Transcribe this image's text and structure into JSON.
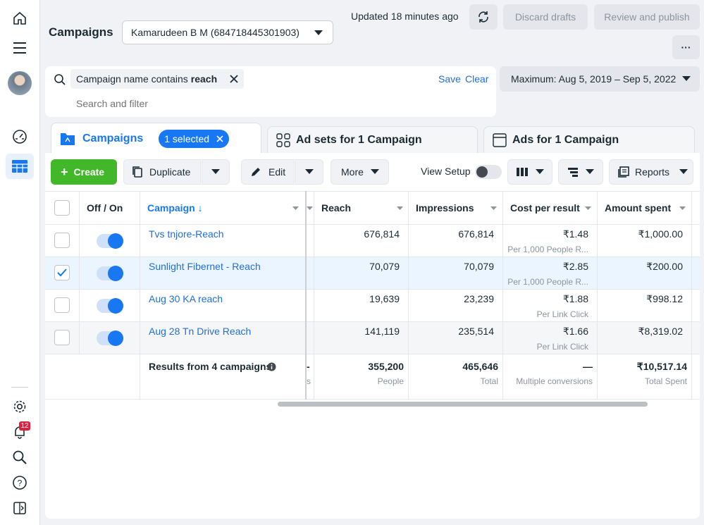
{
  "sidebar": {
    "icons": [
      "home-icon",
      "menu-icon",
      "avatar",
      "gauge-icon",
      "table-icon",
      "settings-icon",
      "bell-icon",
      "search-icon",
      "help-icon",
      "panel-icon"
    ],
    "notification_count": "12"
  },
  "header": {
    "title": "Campaigns",
    "account": "Kamarudeen B M (684718445301903)",
    "updated": "Updated 18 minutes ago",
    "discard_label": "Discard drafts",
    "review_label": "Review and publish",
    "more_label": "···"
  },
  "filter": {
    "chip_prefix": "Campaign name contains ",
    "chip_value": "reach",
    "save_label": "Save",
    "clear_label": "Clear",
    "placeholder": "Search and filter"
  },
  "date_range": "Maximum: Aug 5, 2019 – Sep 5, 2022",
  "tabs": {
    "campaigns": "Campaigns",
    "selected": "1 selected",
    "adsets": "Ad sets for 1 Campaign",
    "ads": "Ads for 1 Campaign"
  },
  "toolbar": {
    "create": "Create",
    "duplicate": "Duplicate",
    "edit": "Edit",
    "more": "More",
    "view_setup": "View Setup",
    "reports": "Reports"
  },
  "columns": {
    "offon": "Off / On",
    "campaign": "Campaign ↓",
    "reach": "Reach",
    "impressions": "Impressions",
    "cpr": "Cost per result",
    "spent": "Amount spent"
  },
  "rows": [
    {
      "name": "Tvs tnjore-Reach",
      "reach": "676,814",
      "impressions": "676,814",
      "cpr": "₹1.48",
      "cpr_sub": "Per 1,000 People R...",
      "spent": "₹1,000.00",
      "selected": false
    },
    {
      "name": "Sunlight Fibernet - Reach",
      "reach": "70,079",
      "impressions": "70,079",
      "cpr": "₹2.85",
      "cpr_sub": "Per 1,000 People R...",
      "spent": "₹200.00",
      "selected": true
    },
    {
      "name": "Aug 30 KA reach",
      "reach": "19,639",
      "impressions": "23,239",
      "cpr": "₹1.88",
      "cpr_sub": "Per Link Click",
      "spent": "₹998.12",
      "selected": false
    },
    {
      "name": "Aug 28 Tn Drive Reach",
      "reach": "141,119",
      "impressions": "235,514",
      "cpr": "₹1.66",
      "cpr_sub": "Per Link Click",
      "spent": "₹8,319.02",
      "selected": false
    }
  ],
  "totals": {
    "label": "Results from 4 campaigns",
    "partial_dash": "-",
    "partial_sub": "s",
    "reach": "355,200",
    "reach_sub": "People",
    "impressions": "465,646",
    "impressions_sub": "Total",
    "cpr": "—",
    "cpr_sub": "Multiple conversions",
    "spent": "₹10,517.14",
    "spent_sub": "Total Spent"
  },
  "colors": {
    "accent": "#1877f2",
    "create": "#42b72a",
    "link": "#216fdb"
  }
}
